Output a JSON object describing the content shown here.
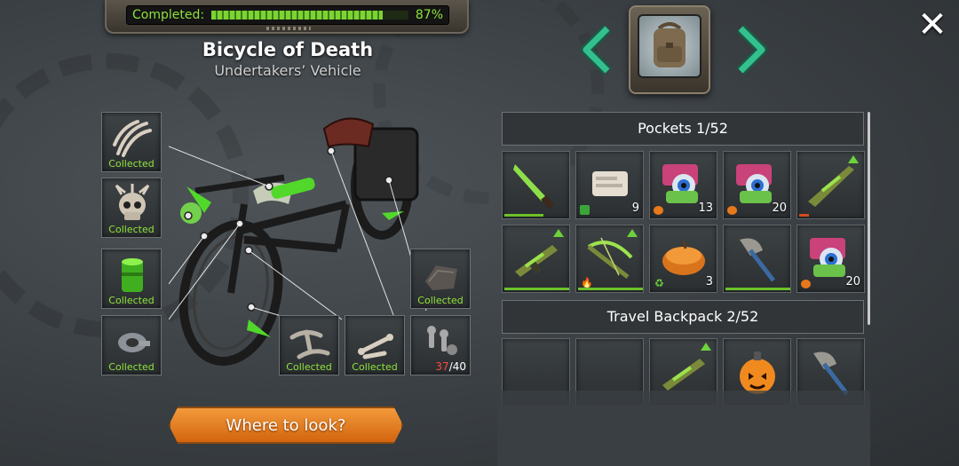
{
  "progress": {
    "label": "Completed:",
    "value_text": "87%",
    "value": 87
  },
  "item": {
    "title": "Bicycle of Death",
    "subtitle": "Undertakers’ Vehicle"
  },
  "components": [
    {
      "name": "claws",
      "status": "Collected"
    },
    {
      "name": "skull",
      "status": "Collected"
    },
    {
      "name": "toxic-canister",
      "status": "Collected"
    },
    {
      "name": "duct-tape",
      "status": "Collected"
    },
    {
      "name": "leather-scrap",
      "status": "Collected"
    },
    {
      "name": "pickaxe-heads",
      "status": "Collected"
    },
    {
      "name": "bones",
      "status": "Collected"
    },
    {
      "name": "bolts",
      "have": "37",
      "need": "/40"
    }
  ],
  "where_button": "Where to look?",
  "pockets": {
    "title": "Pockets 1/52",
    "cells": [
      {
        "icon": "machete-icon",
        "qty": "",
        "durability": 0.6
      },
      {
        "icon": "bandage-icon",
        "qty": "9"
      },
      {
        "icon": "halloween-candy-icon",
        "qty": "13"
      },
      {
        "icon": "halloween-candy-icon",
        "qty": "20"
      },
      {
        "icon": "toxic-rifle-icon",
        "qty": "",
        "durability": 0.15
      },
      {
        "icon": "toxic-smg-icon",
        "qty": "",
        "durability": 1.0
      },
      {
        "icon": "toxic-crossbow-icon",
        "qty": "",
        "durability": 1.0
      },
      {
        "icon": "pumpkin-pie-icon",
        "qty": "3"
      },
      {
        "icon": "axe-icon",
        "qty": "",
        "durability": 1.0
      },
      {
        "icon": "halloween-candy-icon",
        "qty": "20"
      }
    ]
  },
  "backpack": {
    "title": "Travel Backpack 2/52",
    "cells": [
      {
        "icon": ""
      },
      {
        "icon": ""
      },
      {
        "icon": "toxic-rifle-icon"
      },
      {
        "icon": "pumpkin-grenade-icon"
      },
      {
        "icon": "axe-icon"
      }
    ]
  },
  "colors": {
    "accent_green": "#8fe33b",
    "button_orange": "#e07a1f"
  }
}
